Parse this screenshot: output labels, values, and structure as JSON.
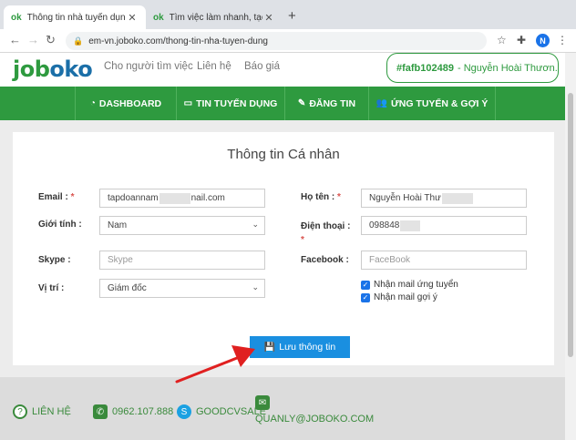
{
  "browser": {
    "tabs": [
      {
        "favicon": "ok",
        "title": "Thông tin nhà tuyển dụng",
        "active": true
      },
      {
        "favicon": "ok",
        "title": "Tìm việc làm nhanh, tạo cv trực tu",
        "active": false
      }
    ],
    "url": "em-vn.joboko.com/thong-tin-nha-tuyen-dung",
    "profile_initial": "N"
  },
  "header": {
    "logo_main": "job",
    "logo_accent": "oko",
    "links": [
      "Cho người tìm việc",
      "Liên hệ",
      "Báo giá"
    ],
    "user_code": "#fafb102489",
    "user_name": "- Nguyễn Hoài Thươn..."
  },
  "nav": {
    "items": [
      {
        "icon": "dashboard-icon",
        "label": "DASHBOARD"
      },
      {
        "icon": "id-card-icon",
        "label": "TIN TUYỂN DỤNG"
      },
      {
        "icon": "edit-icon",
        "label": "ĐĂNG TIN"
      },
      {
        "icon": "users-icon",
        "label": "ỨNG TUYỂN & GỢI Ý"
      }
    ]
  },
  "form": {
    "title": "Thông tin Cá nhân",
    "email_label": "Email :",
    "email_value_start": "tapdoannam",
    "email_value_end": "nail.com",
    "name_label": "Họ tên :",
    "name_value": "Nguyễn Hoài Thư",
    "gender_label": "Giới tính :",
    "gender_value": "Nam",
    "phone_label": "Điện thoại :",
    "phone_value": "098848",
    "skype_label": "Skype :",
    "skype_placeholder": "Skype",
    "facebook_label": "Facebook :",
    "facebook_placeholder": "FaceBook",
    "position_label": "Vị trí :",
    "position_value": "Giám đốc",
    "check_apply": "Nhận mail ứng tuyển",
    "check_suggest": "Nhận mail gợi ý",
    "required_mark": "*",
    "save_label": "Lưu thông tin"
  },
  "footer": {
    "contact": "LIÊN HỆ",
    "phone": "0962.107.888",
    "skype": "GOODCVSALE",
    "email": "QUANLY@JOBOKO.COM"
  },
  "colors": {
    "brand_green": "#2e9a3f",
    "button_blue": "#1a8fe0",
    "arrow_red": "#e02020"
  }
}
